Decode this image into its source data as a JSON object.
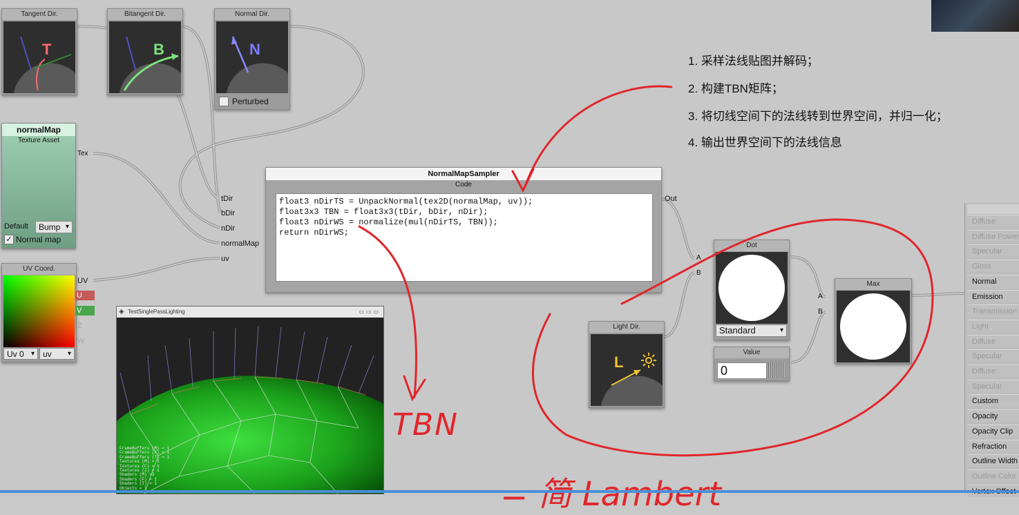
{
  "nodes": {
    "tangent": {
      "title": "Tangent Dir.",
      "letter": "T"
    },
    "bitangent": {
      "title": "Bitangent Dir.",
      "letter": "B"
    },
    "normal": {
      "title": "Normal Dir.",
      "letter": "N",
      "checkbox_label": "Perturbed"
    },
    "normalmap": {
      "title": "normalMap",
      "subtitle": "Texture Asset",
      "out_port": "Tex",
      "default_label": "Default",
      "default_value": "Bump",
      "checkbox_label": "Normal map"
    },
    "uv": {
      "title": "UV Coord.",
      "ports": [
        "UV",
        "U",
        "V",
        "Z",
        "W"
      ],
      "dd1": "Uv 0",
      "dd2": "uv"
    },
    "sampler": {
      "title": "NormalMapSampler",
      "code_label": "Code",
      "in_ports": [
        "tDir",
        "bDir",
        "nDir",
        "normalMap",
        "uv"
      ],
      "out_port": "Out",
      "code_lines": [
        "float3 nDirTS = UnpackNormal(tex2D(normalMap, uv));",
        "float3x3 TBN = float3x3(tDir, bDir, nDir);",
        "float3 nDirWS = normalize(mul(nDirTS, TBN));",
        "return nDirWS;"
      ]
    },
    "dot": {
      "title": "Dot",
      "ports": [
        "A",
        "B"
      ],
      "mode": "Standard"
    },
    "max": {
      "title": "Max",
      "ports": [
        "A",
        "B"
      ]
    },
    "light": {
      "title": "Light Dir.",
      "letter": "L"
    },
    "value": {
      "title": "Value",
      "value": "0"
    }
  },
  "preview_window": {
    "title": "TestSinglePassLighting",
    "stats": [
      "FrameBuffers (M) = 1",
      "FrameBuffers (F) = 1",
      "FrameBuffers (T) = 1",
      "Textures (M) = 1",
      "Textures (F) = 1",
      "Textures (I) = 1",
      "Shaders (M) =3",
      "Shaders (F) = 1",
      "Shaders (I) = 1",
      "Objects = 1"
    ]
  },
  "material_inputs": [
    {
      "label": "Diffuse",
      "enabled": false
    },
    {
      "label": "Diffuse Power",
      "enabled": false
    },
    {
      "label": "Specular",
      "enabled": false
    },
    {
      "label": "Gloss",
      "enabled": false
    },
    {
      "label": "Normal",
      "enabled": true
    },
    {
      "label": "Emission",
      "enabled": true
    },
    {
      "label": "Transmission",
      "enabled": false
    },
    {
      "label": "Light Wrapping",
      "enabled": false
    },
    {
      "label": "Diffuse Ambient",
      "enabled": false
    },
    {
      "label": "Specular Ambient",
      "enabled": false
    },
    {
      "label": "Diffuse Ambient",
      "enabled": false
    },
    {
      "label": "Specular Ambient",
      "enabled": false
    },
    {
      "label": "Custom Lighting",
      "enabled": true
    },
    {
      "label": "Opacity",
      "enabled": true
    },
    {
      "label": "Opacity Clip",
      "enabled": true
    },
    {
      "label": "Refraction",
      "enabled": true
    },
    {
      "label": "Outline Width",
      "enabled": true
    },
    {
      "label": "Outline Color",
      "enabled": false
    },
    {
      "label": "Vertex Offset",
      "enabled": true
    }
  ],
  "annotations": {
    "steps": [
      "1.  采样法线贴图并解码；",
      "2.  构建TBN矩阵；",
      "3.  将切线空间下的法线转到世界空间，并归一化；",
      "4.  输出世界空间下的法线信息"
    ],
    "handwritten_tbn": "TBN",
    "handwritten_bottom": "= 简 Lambert"
  },
  "colors": {
    "tangent": "#ff6b6b",
    "bitangent": "#7ee37e",
    "normal": "#7b7bff",
    "light": "#f2c230",
    "annotation_red": "#e0262b"
  }
}
